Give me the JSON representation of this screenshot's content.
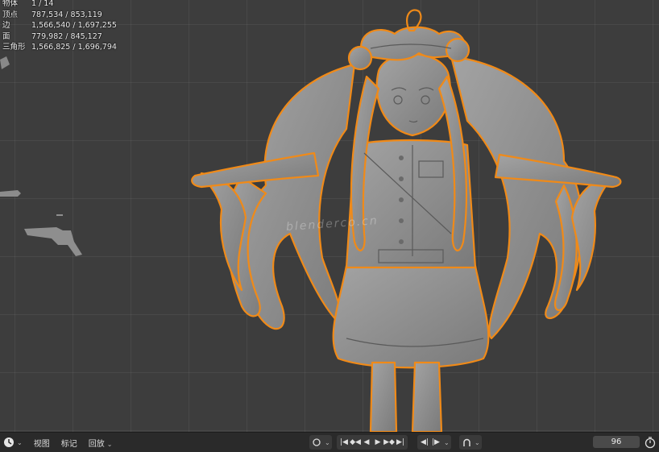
{
  "stats": [
    {
      "label": "物体",
      "value": "1 / 14"
    },
    {
      "label": "顶点",
      "value": "787,534 / 853,119"
    },
    {
      "label": "边",
      "value": "1,566,540 / 1,697,255"
    },
    {
      "label": "面",
      "value": "779,982 / 845,127"
    },
    {
      "label": "三角形",
      "value": "1,566,825 / 1,696,794"
    }
  ],
  "watermark": "blenderco.cn",
  "timeline": {
    "menus": [
      "视图",
      "标记",
      "回放"
    ],
    "current_frame": "96",
    "icons": [
      "mode-icon",
      "record-icon",
      "jump-start-icon",
      "prev-keyframe-icon",
      "play-reverse-icon",
      "play-icon",
      "next-keyframe-icon",
      "jump-end-icon",
      "prev-marker-icon",
      "next-marker-icon",
      "auto-key-icon",
      "stopwatch-icon"
    ]
  },
  "colors": {
    "selection_outline": "#f08a18",
    "viewport_bg": "#3d3d3d",
    "model": "#8f8f8f"
  }
}
